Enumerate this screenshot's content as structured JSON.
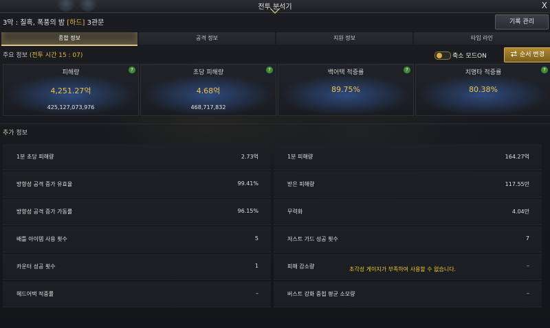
{
  "window": {
    "title": "전투 분석기",
    "close_glyph": "X"
  },
  "stage": {
    "prefix": "3막 : 칠흑, 폭풍의 밤",
    "difficulty": "[하드]",
    "gate": "3관문"
  },
  "record_button": "기록 관리",
  "tabs": [
    {
      "label": "종합 정보",
      "active": true
    },
    {
      "label": "공격 정보",
      "active": false
    },
    {
      "label": "지원 정보",
      "active": false
    },
    {
      "label": "타임 라인",
      "active": false
    }
  ],
  "main_info": {
    "label": "주요 정보",
    "battle_time": "(전투 시간 15 : 07)"
  },
  "compact_mode": {
    "label": "축소 모드ON",
    "enabled": true
  },
  "order_button": {
    "icon": "swap-icon",
    "label": "순서 변경"
  },
  "stat_cards": [
    {
      "name": "피해량",
      "value": "4,251.27억",
      "sub": "425,127,073,976"
    },
    {
      "name": "초당 피해량",
      "value": "4.68억",
      "sub": "468,717,832"
    },
    {
      "name": "백어택 적중률",
      "value": "89.75%",
      "sub": ""
    },
    {
      "name": "치명타 적중률",
      "value": "80.38%",
      "sub": ""
    }
  ],
  "help_glyph": "?",
  "extra_info": {
    "label": "추가 정보",
    "left": [
      {
        "label": "1분 초당 피해량",
        "value": "2.73억"
      },
      {
        "label": "방향성 공격 증가 유효율",
        "value": "99.41%"
      },
      {
        "label": "방향성 공격 증가 가동률",
        "value": "96.15%"
      },
      {
        "label": "배틀 아이템 사용 횟수",
        "value": "5"
      },
      {
        "label": "카운터 성공 횟수",
        "value": "1"
      },
      {
        "label": "헤드어택 적중률",
        "value": "–"
      }
    ],
    "right": [
      {
        "label": "1분 피해량",
        "value": "164.27억"
      },
      {
        "label": "받은 피해량",
        "value": "117.55만"
      },
      {
        "label": "무력화",
        "value": "4.04만"
      },
      {
        "label": "저스트 가드 성공 횟수",
        "value": "7"
      },
      {
        "label": "피해 감소량",
        "value": "–"
      },
      {
        "label": "버스트 강화 중첩 평균 소모량",
        "value": "–"
      }
    ]
  },
  "notice": "초각성 게이지가 부족하여 사용할 수 없습니다.",
  "colors": {
    "accent_gold": "#e8b84a",
    "value_gold": "#f0c24a",
    "help_green": "#3f8a32",
    "notice_yellow": "#f0c830"
  }
}
